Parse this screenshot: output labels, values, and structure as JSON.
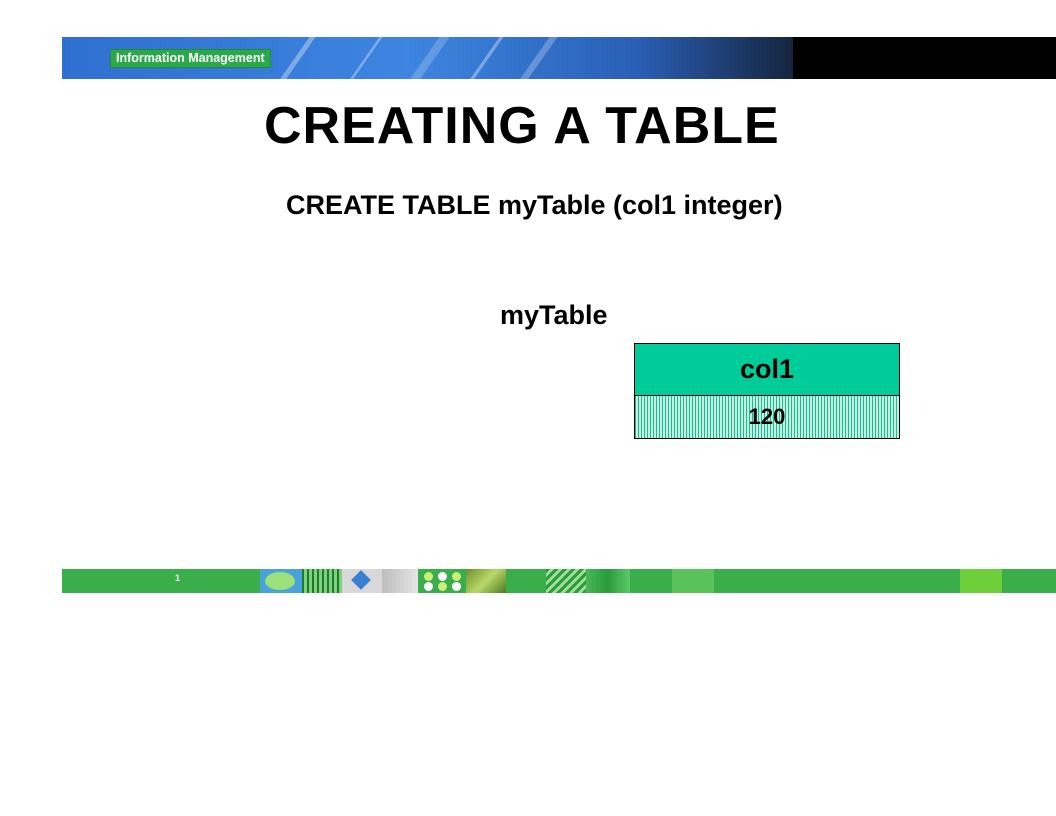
{
  "header": {
    "badge_label": "Information Management"
  },
  "slide": {
    "title": "CREATING A TABLE",
    "statement": "CREATE TABLE myTable (col1 integer)",
    "table_name": "myTable",
    "table": {
      "column_header": "col1",
      "cell_value": "120"
    }
  },
  "footer": {
    "page_number": "1"
  },
  "colors": {
    "header_fill": "#00cc99",
    "badge_green": "#2aa84a",
    "footer_green": "#3aae4a"
  }
}
